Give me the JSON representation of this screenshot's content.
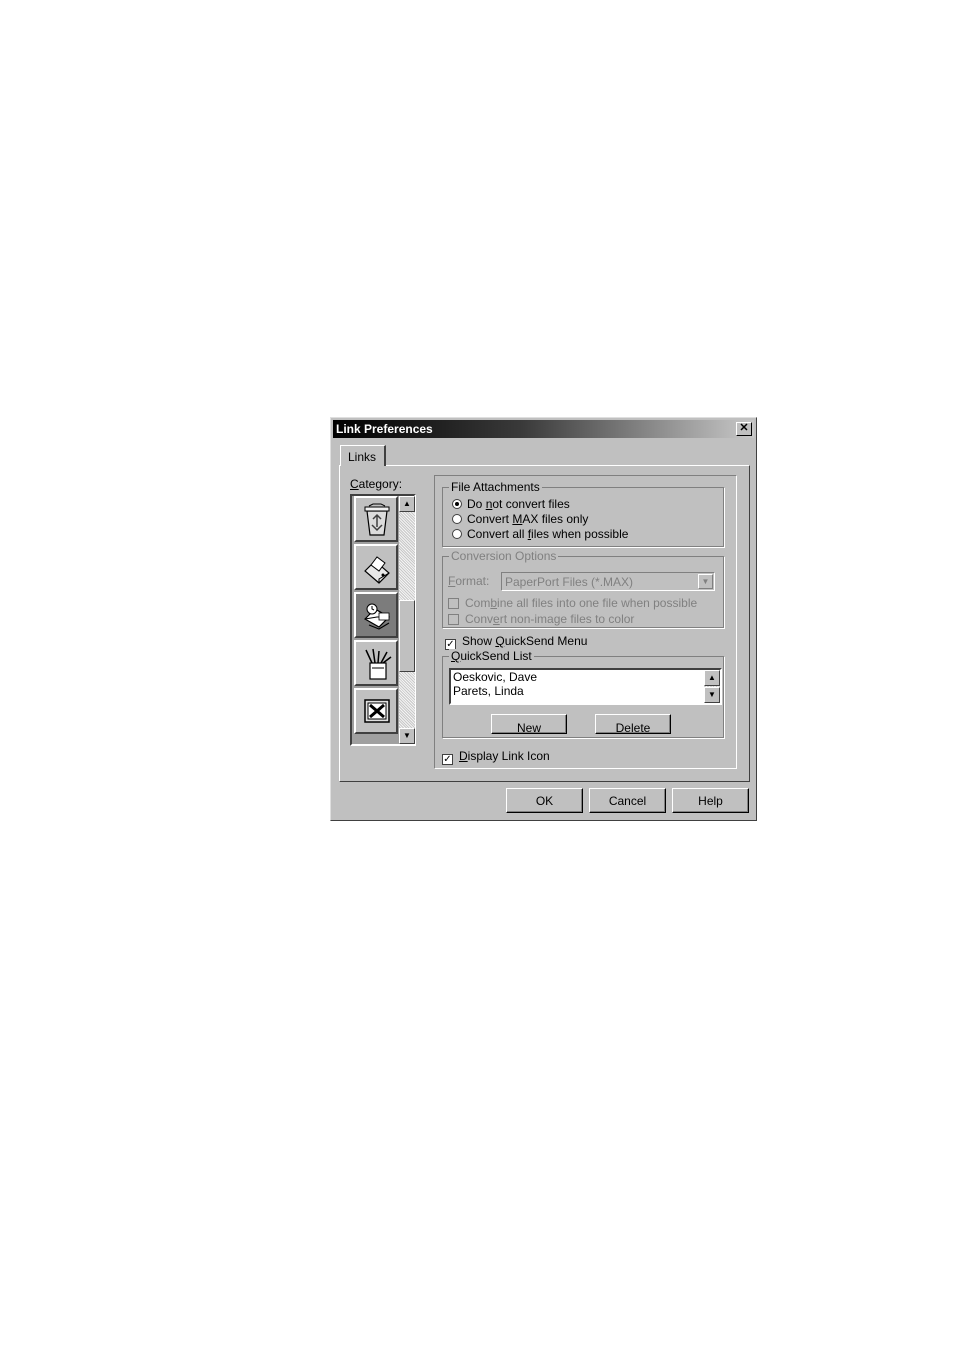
{
  "dialog": {
    "title": "Link Preferences",
    "close_glyph": "✕"
  },
  "tabs": [
    {
      "label": "Links"
    }
  ],
  "category": {
    "label_first": "C",
    "label_rest": "ategory:",
    "items": [
      {
        "icon": "recycle-bin-icon"
      },
      {
        "icon": "printer-icon"
      },
      {
        "icon": "mail-link-icon",
        "selected": true
      },
      {
        "icon": "paint-tools-icon"
      },
      {
        "icon": "excel-icon"
      }
    ]
  },
  "file_attachments": {
    "legend": "File Attachments",
    "options": [
      {
        "before": "Do ",
        "key": "n",
        "after": "ot convert files",
        "selected": true
      },
      {
        "before": "Convert ",
        "key": "M",
        "after": "AX files only",
        "selected": false
      },
      {
        "before": "Convert all ",
        "key": "f",
        "after": "iles when possible",
        "selected": false
      }
    ]
  },
  "conversion_options": {
    "legend": "Conversion Options",
    "format_key": "F",
    "format_rest": "ormat:",
    "format_value": "PaperPort Files (*.MAX)",
    "combine_key": "b",
    "combine_before": "Com",
    "combine_after": "ine all files into one file when possible",
    "color_before": "Conv",
    "color_key": "e",
    "color_after": "rt non-image files to color"
  },
  "quicksend": {
    "show_before": "Show ",
    "show_key": "Q",
    "show_after": "uickSend Menu",
    "show_checked": true,
    "list_key": "Q",
    "list_rest": "uickSend List",
    "entries": [
      "Oeskovic, Dave",
      "Parets, Linda"
    ],
    "new_before": "Ne",
    "new_key": "w",
    "delete_before": "De",
    "delete_key": "l",
    "delete_after": "ete"
  },
  "display_link_icon": {
    "key": "D",
    "rest": "isplay Link Icon",
    "checked": true
  },
  "footer": {
    "ok": "OK",
    "cancel": "Cancel",
    "help": "Help"
  }
}
